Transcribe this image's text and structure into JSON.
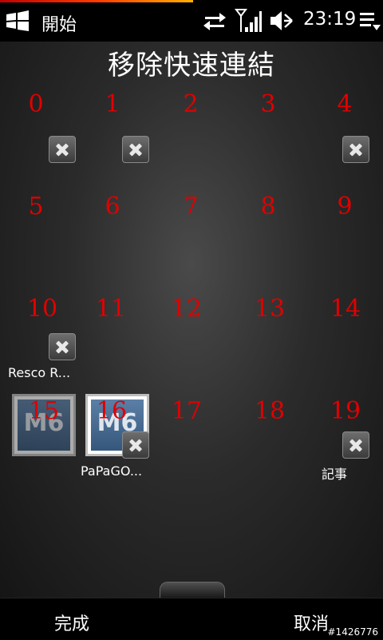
{
  "status_bar": {
    "start_label": "開始",
    "time": "23:19",
    "icons": [
      "windows-start-icon",
      "data-sync-icon",
      "signal-strength-icon",
      "volume-muted-icon",
      "menu-icon"
    ]
  },
  "page": {
    "title": "移除快速連結"
  },
  "grid": {
    "numbers": [
      "0",
      "1",
      "2",
      "3",
      "4",
      "5",
      "6",
      "7",
      "8",
      "9",
      "10",
      "11",
      "12",
      "13",
      "14",
      "15",
      "16",
      "17",
      "18",
      "19"
    ],
    "app_labels": {
      "resco": "Resco R...",
      "papago": "PaPaGO...",
      "notes": "記事"
    },
    "tile_text": {
      "m6_a": "M6",
      "m6_b": "M6"
    }
  },
  "softkeys": {
    "left": "完成",
    "right": "取消"
  },
  "watermark": "#1426776",
  "colors": {
    "number_red": "#e00000",
    "background": "#000000"
  }
}
